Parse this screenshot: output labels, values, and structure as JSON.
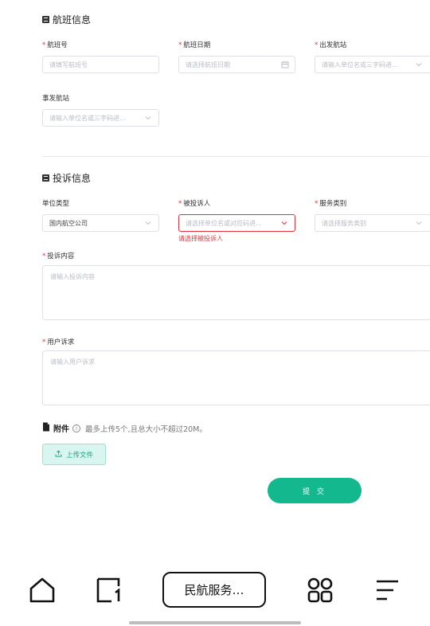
{
  "flight_section": {
    "title": "航班信息",
    "flight_no": {
      "label": "航班号",
      "required": true,
      "placeholder": "请填写航班号"
    },
    "flight_date": {
      "label": "航班日期",
      "required": true,
      "placeholder": "请选择航班日期"
    },
    "departure": {
      "label": "出发航站",
      "required": true,
      "placeholder": "请输入单位名或三字码进…"
    },
    "incident_station": {
      "label": "事发航站",
      "required": false,
      "placeholder": "请输入单位名或三字码进…"
    }
  },
  "complaint_section": {
    "title": "投诉信息",
    "unit_type": {
      "label": "单位类型",
      "required": false,
      "value": "国内航空公司"
    },
    "respondent": {
      "label": "被投诉人",
      "required": true,
      "placeholder": "请选择单位名或对应码进…",
      "error": "请选择被投诉人"
    },
    "service_type": {
      "label": "服务类别",
      "required": true,
      "placeholder": "请选择服务类别"
    },
    "content": {
      "label": "投诉内容",
      "required": true,
      "placeholder": "请输入投诉内容"
    },
    "demand": {
      "label": "用户诉求",
      "required": true,
      "placeholder": "请输入用户诉求"
    }
  },
  "attachment": {
    "title": "附件",
    "tip": "最多上传5个,且总大小不超过20M。",
    "upload_label": "上传文件"
  },
  "submit_label": "提 交",
  "bottom_nav": {
    "center_label": "民航服务…",
    "items": [
      "home-icon",
      "tab-1-icon",
      "apps-icon",
      "menu-icon"
    ]
  },
  "colors": {
    "accent": "#14b88f",
    "error": "#e5303b"
  }
}
